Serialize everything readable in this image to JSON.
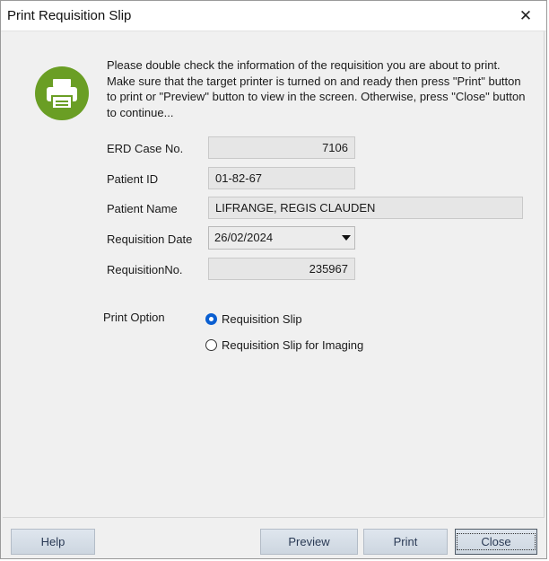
{
  "window": {
    "title": "Print Requisition Slip",
    "close_glyph": "✕"
  },
  "icons": {
    "printer": "printer-icon",
    "close": "close-icon"
  },
  "colors": {
    "icon_circle": "#6a9e24",
    "radio_checked": "#0a5fd1"
  },
  "message": "Please double check the information of the requisition you are about to print. Make sure that the target printer is turned on and ready then press \"Print\" button to print or \"Preview\" button to view in the screen. Otherwise, press \"Close\" button to continue...",
  "fields": {
    "erd_case_label": "ERD Case No.",
    "erd_case_value": "7106",
    "patient_id_label": "Patient ID",
    "patient_id_value": "01-82-67",
    "patient_name_label": "Patient Name",
    "patient_name_value": "LIFRANGE, REGIS CLAUDEN",
    "req_date_label": "Requisition Date",
    "req_date_value": "26/02/2024",
    "req_no_label": "RequisitionNo.",
    "req_no_value": "235967"
  },
  "print_option": {
    "label": "Print Option",
    "options": [
      {
        "label": "Requisition Slip",
        "selected": true
      },
      {
        "label": "Requisition Slip for Imaging",
        "selected": false
      }
    ]
  },
  "buttons": {
    "help": "Help",
    "preview": "Preview",
    "print": "Print",
    "close": "Close"
  }
}
